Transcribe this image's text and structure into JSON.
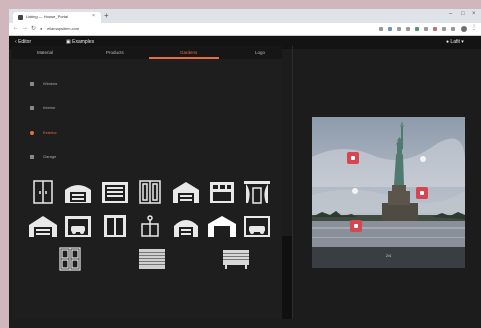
{
  "browser": {
    "tab_title": "Listing — House_Portal",
    "url": "ellamapsitem.com"
  },
  "app": {
    "back_label": "Editor",
    "export_label": "Examples",
    "account_label": "Lafit"
  },
  "tabs": [
    {
      "label": "Material"
    },
    {
      "label": "Products"
    },
    {
      "label": "Gardens"
    },
    {
      "label": "Logo"
    }
  ],
  "options": [
    {
      "label": "Window",
      "selected": false
    },
    {
      "label": "Interior",
      "selected": false
    },
    {
      "label": "Exterior",
      "selected": true
    },
    {
      "label": "Garage",
      "selected": false
    }
  ],
  "accent_color": "#e46f3d",
  "pin_color": "#d64550",
  "gallery": [
    {
      "icon": "double-door-icon"
    },
    {
      "icon": "arched-garage-icon"
    },
    {
      "icon": "garage-door-icon"
    },
    {
      "icon": "french-door-icon"
    },
    {
      "icon": "garage-house-icon"
    },
    {
      "icon": "garage-windows-icon"
    },
    {
      "icon": "curtain-door-icon"
    },
    {
      "icon": "house-garage-icon"
    },
    {
      "icon": "car-garage-icon"
    },
    {
      "icon": "double-panel-door-icon"
    },
    {
      "icon": "small-cabinet-icon"
    },
    {
      "icon": "dome-garage-icon"
    },
    {
      "icon": "white-garage-icon"
    },
    {
      "icon": "car-port-icon"
    },
    {
      "icon": "glass-door-icon"
    },
    {
      "icon": "shutter-door-icon"
    },
    {
      "icon": "roller-shutter-icon"
    }
  ],
  "photo": {
    "subject": "statue-of-liberty",
    "caption": "2/4"
  }
}
